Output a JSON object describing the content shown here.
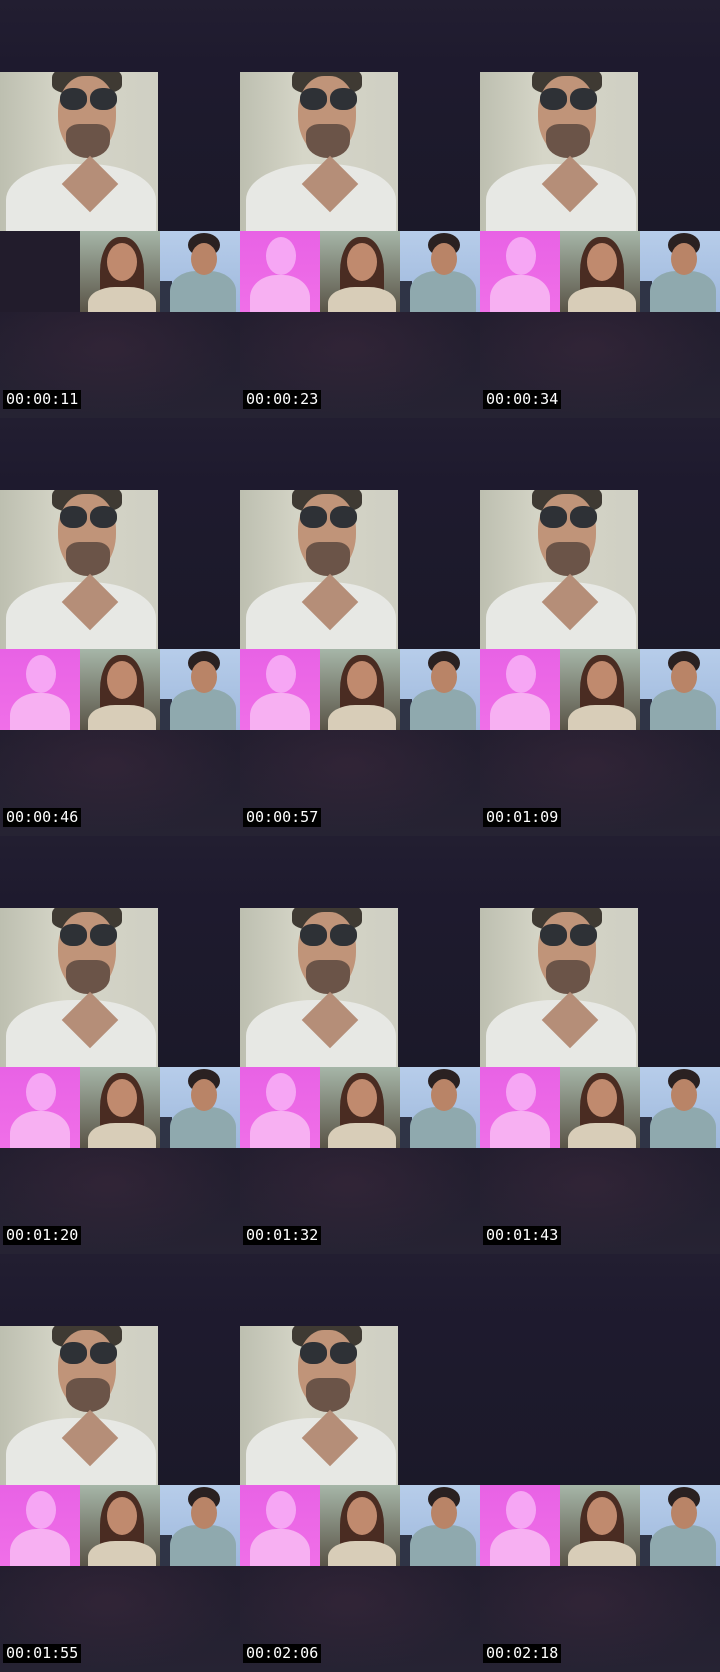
{
  "contact_sheet": {
    "columns": 3,
    "frames": [
      {
        "timestamp": "00:00:11",
        "main_visible": true,
        "self_tile": "empty"
      },
      {
        "timestamp": "00:00:23",
        "main_visible": true,
        "self_tile": "avatar"
      },
      {
        "timestamp": "00:00:34",
        "main_visible": true,
        "self_tile": "avatar"
      },
      {
        "timestamp": "00:00:46",
        "main_visible": true,
        "self_tile": "avatar"
      },
      {
        "timestamp": "00:00:57",
        "main_visible": true,
        "self_tile": "avatar"
      },
      {
        "timestamp": "00:01:09",
        "main_visible": true,
        "self_tile": "avatar"
      },
      {
        "timestamp": "00:01:20",
        "main_visible": true,
        "self_tile": "avatar"
      },
      {
        "timestamp": "00:01:32",
        "main_visible": true,
        "self_tile": "avatar"
      },
      {
        "timestamp": "00:01:43",
        "main_visible": true,
        "self_tile": "avatar"
      },
      {
        "timestamp": "00:01:55",
        "main_visible": true,
        "self_tile": "avatar"
      },
      {
        "timestamp": "00:02:06",
        "main_visible": true,
        "self_tile": "avatar"
      },
      {
        "timestamp": "00:02:18",
        "main_visible": false,
        "self_tile": "avatar"
      }
    ]
  },
  "colors": {
    "background": "#1a1728",
    "avatar_tile": "#ec68e6",
    "timestamp_bg": "#000000",
    "timestamp_text": "#ffffff"
  },
  "icons": {
    "avatar": "default-person-silhouette-icon"
  }
}
